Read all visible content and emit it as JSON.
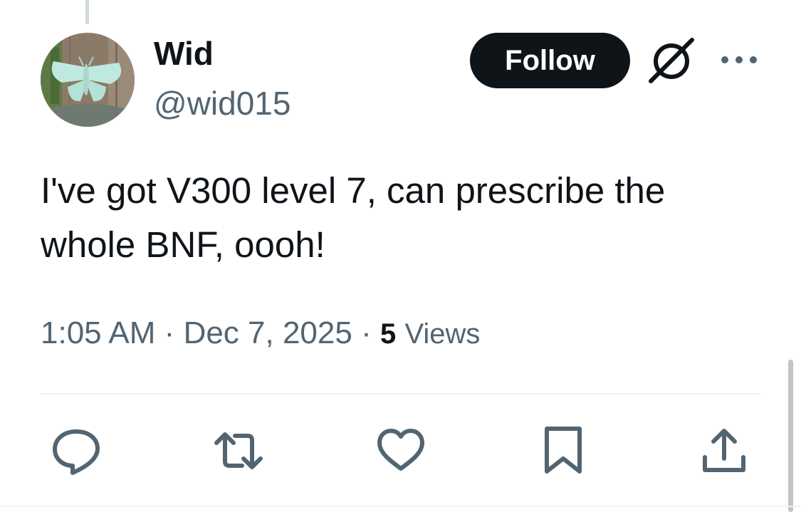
{
  "user": {
    "display_name": "Wid",
    "handle": "@wid015",
    "avatar_icon": "green-moth-avatar"
  },
  "header": {
    "follow_label": "Follow",
    "grok_icon": "grok-icon",
    "more_icon": "more-icon"
  },
  "tweet": {
    "text": "I've got V300 level 7, can prescribe the whole BNF, oooh!",
    "time": "1:05 AM",
    "separator": "·",
    "date": "Dec 7, 2025",
    "views_count": "5",
    "views_label": "Views"
  },
  "actions": [
    {
      "icon": "reply-icon"
    },
    {
      "icon": "retweet-icon"
    },
    {
      "icon": "like-icon"
    },
    {
      "icon": "bookmark-icon"
    },
    {
      "icon": "share-icon"
    }
  ],
  "colors": {
    "primary_text": "#0f1419",
    "secondary_text": "#536471",
    "icon_color": "#536471",
    "follow_bg": "#0f1419",
    "follow_text": "#ffffff",
    "divider": "#eff3f4"
  }
}
